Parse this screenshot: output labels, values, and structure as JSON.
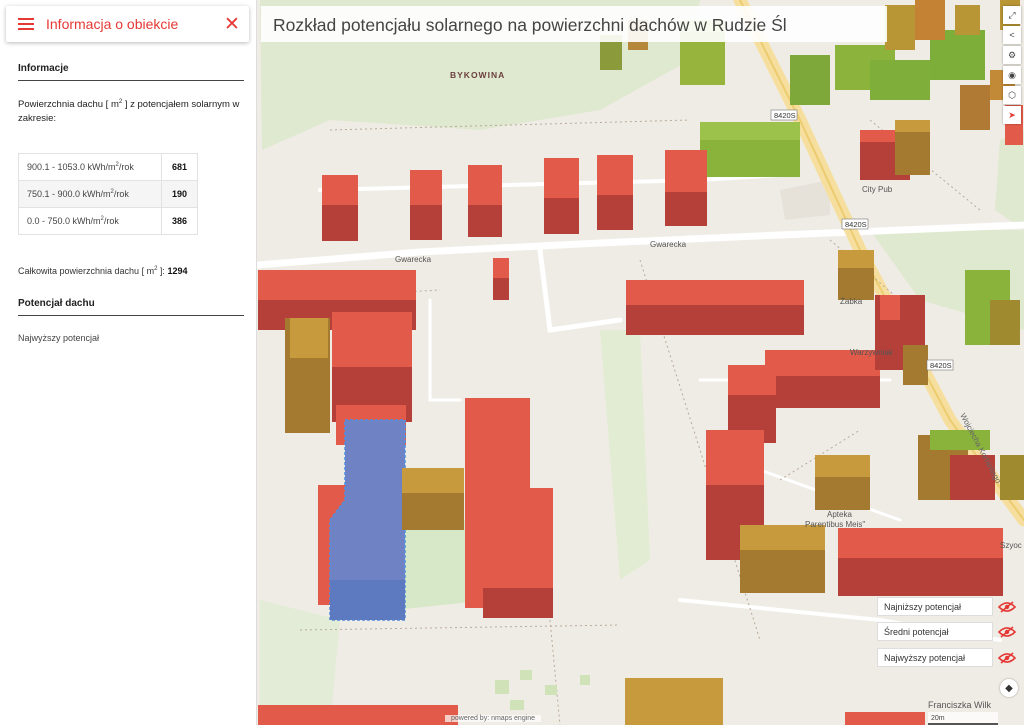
{
  "sidebar": {
    "title": "Informacja o obiekcie",
    "section_info": "Informacje",
    "desc_before": "Powierzchnia dachu [ m",
    "desc_sup": "2",
    "desc_after": " ] z potencjałem solarnym w zakresie:",
    "ranges": [
      {
        "pre": "900.1 - 1053.0 kWh/m",
        "sup": "2",
        "post": "/rok",
        "value": "681"
      },
      {
        "pre": "750.1 - 900.0 kWh/m",
        "sup": "2",
        "post": "/rok",
        "value": "190"
      },
      {
        "pre": "0.0 - 750.0 kWh/m",
        "sup": "2",
        "post": "/rok",
        "value": "386"
      }
    ],
    "total_before": "Całkowita powierzchnia dachu [ m",
    "total_sup": "2",
    "total_after": " ]: ",
    "total_value": "1294",
    "section_potential": "Potencjał dachu",
    "potential_value": "Najwyższy potencjał"
  },
  "map": {
    "title": "Rozkład potencjału solarnego na powierzchni dachów w Rudzie Śl",
    "labels": {
      "district": "BYKOWINA",
      "street_gwarecka_1": "Gwarecka",
      "street_gwarecka_2": "Gwarecka",
      "road_8420s_1": "8420S",
      "road_8420s_2": "8420S",
      "road_8420s_3": "8420S",
      "poi_city_pub": "City Pub",
      "poi_zabka": "Żabka",
      "poi_warzywniak": "Warzywniak",
      "poi_apteka_1": "Apteka",
      "poi_apteka_2": "Parentibus Meis\"",
      "street_wojciecha": "Wojciecha Korfantego",
      "street_franciszka": "Franciszka Wilk",
      "street_szyoc": "Szyoc"
    },
    "tools": [
      "⤢",
      "<",
      "⚙",
      "◉",
      "⬡",
      "➤"
    ],
    "legend": [
      {
        "label": "Najniższy potencjał"
      },
      {
        "label": "Średni potencjał"
      },
      {
        "label": "Najwyższy potencjał"
      }
    ],
    "attribution": "powered by: nmaps engine",
    "scale": "20m"
  },
  "colors": {
    "accent": "#e53935",
    "highest": "#e25a49",
    "medium": "#b8862e",
    "lowest": "#8bb23e",
    "selected": "#6f82c4"
  }
}
